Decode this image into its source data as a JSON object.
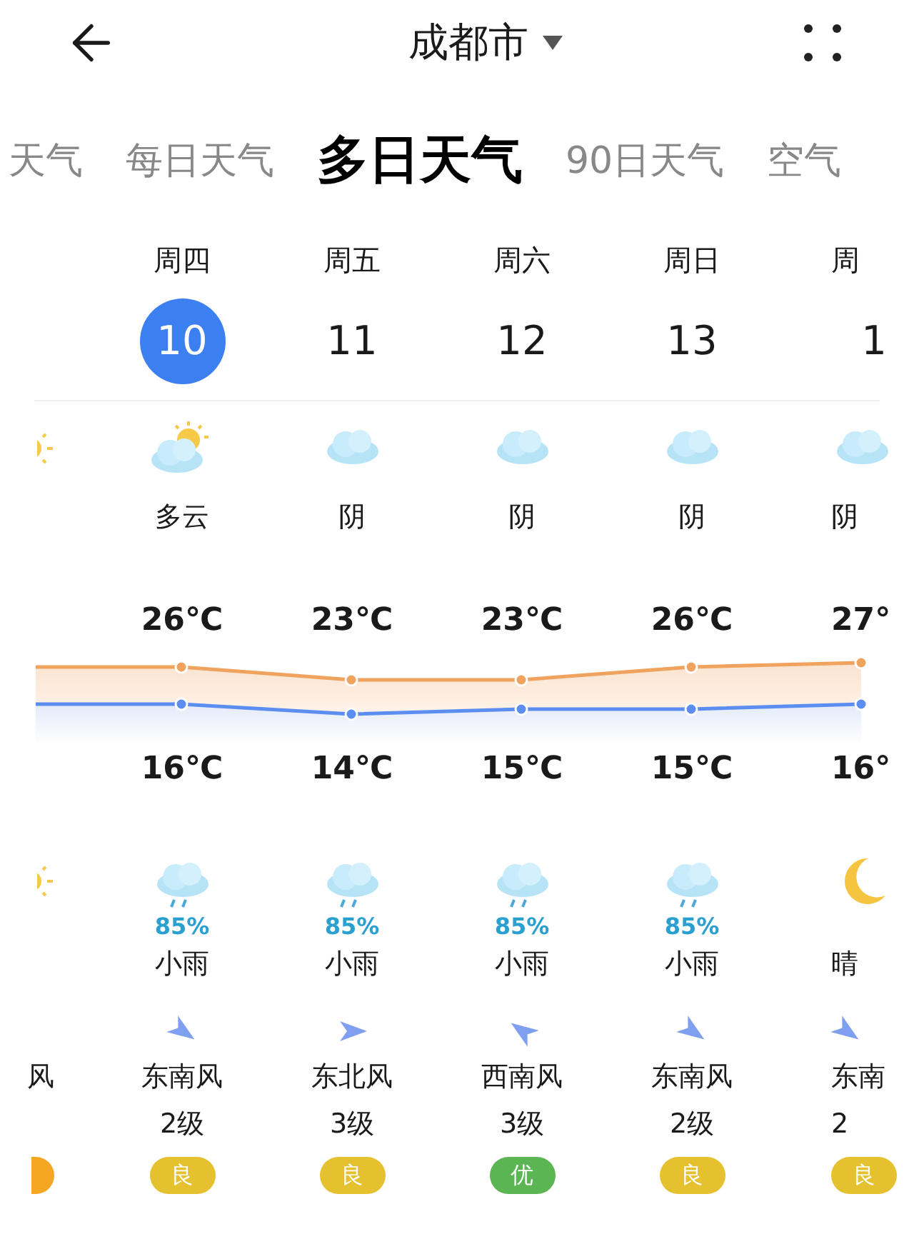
{
  "header": {
    "title": "成都市"
  },
  "tabs": [
    {
      "label": "天气",
      "selected": false
    },
    {
      "label": "每日天气",
      "selected": false
    },
    {
      "label": "多日天气",
      "selected": true
    },
    {
      "label": "90日天气",
      "selected": false
    },
    {
      "label": "空气",
      "selected": false
    }
  ],
  "days": [
    {
      "sky": {
        "kind": "sun"
      },
      "rain": {
        "kind": "sun"
      },
      "wind": {
        "label": "风"
      },
      "aqi": {
        "color": "#f5a623"
      }
    },
    {
      "weekday": "周四",
      "date": "10",
      "selected": true,
      "sky": {
        "kind": "partlycloudy",
        "label": "多云"
      },
      "high": "26℃",
      "low": "16℃",
      "rain": {
        "kind": "rain",
        "chance": "85%",
        "label": "小雨"
      },
      "wind": {
        "kind": "southeast",
        "label": "东南风",
        "level": "2级"
      },
      "aqi": {
        "label": "良",
        "color": "#e6c12f"
      }
    },
    {
      "weekday": "周五",
      "date": "11",
      "selected": false,
      "sky": {
        "kind": "cloudy",
        "label": "阴"
      },
      "high": "23℃",
      "low": "14℃",
      "rain": {
        "kind": "rain",
        "chance": "85%",
        "label": "小雨"
      },
      "wind": {
        "kind": "northeast",
        "label": "东北风",
        "level": "3级"
      },
      "aqi": {
        "label": "良",
        "color": "#e6c12f"
      }
    },
    {
      "weekday": "周六",
      "date": "12",
      "selected": false,
      "sky": {
        "kind": "cloudy",
        "label": "阴"
      },
      "high": "23℃",
      "low": "15℃",
      "rain": {
        "kind": "rain",
        "chance": "85%",
        "label": "小雨"
      },
      "wind": {
        "kind": "southwest",
        "label": "西南风",
        "level": "3级"
      },
      "aqi": {
        "label": "优",
        "color": "#5ab552"
      }
    },
    {
      "weekday": "周日",
      "date": "13",
      "selected": false,
      "sky": {
        "kind": "cloudy",
        "label": "阴"
      },
      "high": "26℃",
      "low": "15℃",
      "rain": {
        "kind": "rain",
        "chance": "85%",
        "label": "小雨"
      },
      "wind": {
        "kind": "southeast",
        "label": "东南风",
        "level": "2级"
      },
      "aqi": {
        "label": "良",
        "color": "#e6c12f"
      }
    },
    {
      "weekday": "周",
      "date": "1",
      "selected": false,
      "sky": {
        "kind": "cloudy",
        "label": "阴"
      },
      "high": "27°",
      "low": "16°",
      "rain": {
        "kind": "moon",
        "label": "晴"
      },
      "wind": {
        "kind": "southeast",
        "label": "东南",
        "level": "2"
      },
      "aqi": {
        "label": "良",
        "color": "#e6c12f"
      }
    }
  ]
}
